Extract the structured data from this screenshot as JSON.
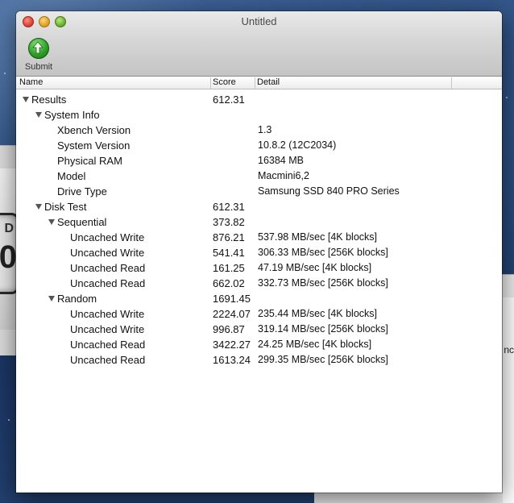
{
  "window": {
    "title": "Untitled"
  },
  "toolbar": {
    "submit_label": "Submit"
  },
  "columns": {
    "name": "Name",
    "score": "Score",
    "detail": "Detail"
  },
  "background": {
    "right_text": "nc",
    "left_big": "0",
    "left_small": "D"
  },
  "rows": [
    {
      "level": 0,
      "expand": true,
      "name": "Results",
      "score": "612.31",
      "detail": ""
    },
    {
      "level": 1,
      "expand": true,
      "name": "System Info",
      "score": "",
      "detail": ""
    },
    {
      "level": 2,
      "expand": false,
      "name": "Xbench Version",
      "score": "",
      "detail": "1.3"
    },
    {
      "level": 2,
      "expand": false,
      "name": "System Version",
      "score": "",
      "detail": "10.8.2 (12C2034)"
    },
    {
      "level": 2,
      "expand": false,
      "name": "Physical RAM",
      "score": "",
      "detail": "16384 MB"
    },
    {
      "level": 2,
      "expand": false,
      "name": "Model",
      "score": "",
      "detail": "Macmini6,2"
    },
    {
      "level": 2,
      "expand": false,
      "name": "Drive Type",
      "score": "",
      "detail": "Samsung SSD 840 PRO Series"
    },
    {
      "level": 1,
      "expand": true,
      "name": "Disk Test",
      "score": "612.31",
      "detail": ""
    },
    {
      "level": 2,
      "expand": true,
      "name": "Sequential",
      "score": "373.82",
      "detail": ""
    },
    {
      "level": 3,
      "expand": false,
      "name": "Uncached Write",
      "score": "876.21",
      "detail": "537.98 MB/sec [4K blocks]"
    },
    {
      "level": 3,
      "expand": false,
      "name": "Uncached Write",
      "score": "541.41",
      "detail": "306.33 MB/sec [256K blocks]"
    },
    {
      "level": 3,
      "expand": false,
      "name": "Uncached Read",
      "score": "161.25",
      "detail": "47.19 MB/sec [4K blocks]"
    },
    {
      "level": 3,
      "expand": false,
      "name": "Uncached Read",
      "score": "662.02",
      "detail": "332.73 MB/sec [256K blocks]"
    },
    {
      "level": 2,
      "expand": true,
      "name": "Random",
      "score": "1691.45",
      "detail": ""
    },
    {
      "level": 3,
      "expand": false,
      "name": "Uncached Write",
      "score": "2224.07",
      "detail": "235.44 MB/sec [4K blocks]"
    },
    {
      "level": 3,
      "expand": false,
      "name": "Uncached Write",
      "score": "996.87",
      "detail": "319.14 MB/sec [256K blocks]"
    },
    {
      "level": 3,
      "expand": false,
      "name": "Uncached Read",
      "score": "3422.27",
      "detail": "24.25 MB/sec [4K blocks]"
    },
    {
      "level": 3,
      "expand": false,
      "name": "Uncached Read",
      "score": "1613.24",
      "detail": "299.35 MB/sec [256K blocks]"
    }
  ]
}
